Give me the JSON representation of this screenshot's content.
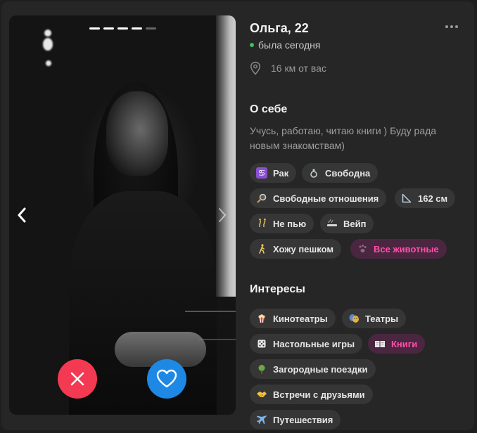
{
  "profile": {
    "name": "Ольга, 22",
    "status": "была сегодня",
    "distance": "16 км от вас"
  },
  "photo": {
    "count": 6,
    "active_index": 4
  },
  "about": {
    "heading": "О себе",
    "text": "Учусь, работаю, читаю книги ) Буду рада новым знакомствам)"
  },
  "traits": [
    {
      "label": "Рак",
      "icon": "zodiac-cancer-icon"
    },
    {
      "label": "Свободна",
      "icon": "ring-icon"
    },
    {
      "label": "Свободные отношения",
      "icon": "magnifier-icon"
    },
    {
      "label": "162 см",
      "icon": "ruler-triangle-icon"
    },
    {
      "label": "Не пью",
      "icon": "champagne-icon"
    },
    {
      "label": "Вейп",
      "icon": "vape-icon"
    },
    {
      "label": "Хожу пешком",
      "icon": "walking-icon"
    },
    {
      "label": "Все животные",
      "icon": "paw-icon",
      "highlighted": true
    }
  ],
  "interests": {
    "heading": "Интересы",
    "items": [
      {
        "label": "Кинотеатры",
        "icon": "popcorn-icon"
      },
      {
        "label": "Театры",
        "icon": "theater-masks-icon"
      },
      {
        "label": "Настольные игры",
        "icon": "dice-icon"
      },
      {
        "label": "Книги",
        "icon": "book-icon",
        "highlighted": true
      },
      {
        "label": "Загородные поездки",
        "icon": "tree-icon"
      },
      {
        "label": "Встречи с друзьями",
        "icon": "handshake-icon"
      },
      {
        "label": "Путешествия",
        "icon": "airplane-icon"
      }
    ]
  },
  "colors": {
    "background": "#262626",
    "chip": "#363636",
    "highlight_chip_bg": "#4a2640",
    "highlight_text": "#ff4fa8",
    "dislike": "#f33a52",
    "like": "#1e88e5",
    "online": "#3fbf5f"
  }
}
